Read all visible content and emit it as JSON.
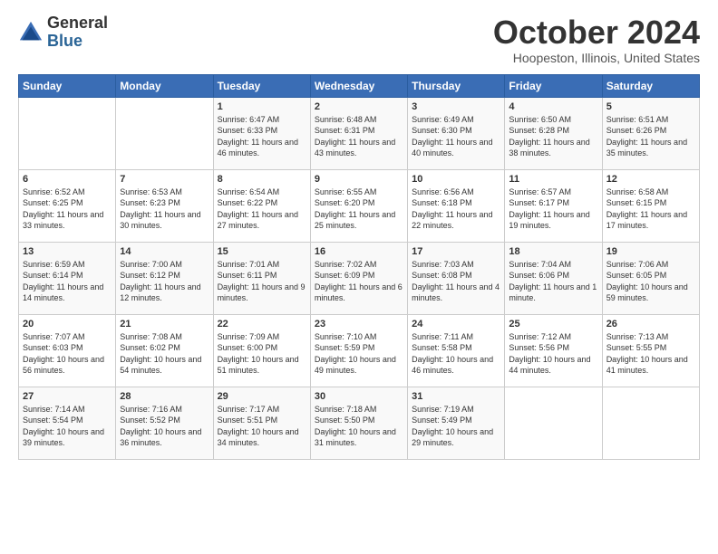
{
  "logo": {
    "general": "General",
    "blue": "Blue"
  },
  "header": {
    "month": "October 2024",
    "location": "Hoopeston, Illinois, United States"
  },
  "days_of_week": [
    "Sunday",
    "Monday",
    "Tuesday",
    "Wednesday",
    "Thursday",
    "Friday",
    "Saturday"
  ],
  "weeks": [
    [
      {
        "day": "",
        "info": ""
      },
      {
        "day": "",
        "info": ""
      },
      {
        "day": "1",
        "info": "Sunrise: 6:47 AM\nSunset: 6:33 PM\nDaylight: 11 hours and 46 minutes."
      },
      {
        "day": "2",
        "info": "Sunrise: 6:48 AM\nSunset: 6:31 PM\nDaylight: 11 hours and 43 minutes."
      },
      {
        "day": "3",
        "info": "Sunrise: 6:49 AM\nSunset: 6:30 PM\nDaylight: 11 hours and 40 minutes."
      },
      {
        "day": "4",
        "info": "Sunrise: 6:50 AM\nSunset: 6:28 PM\nDaylight: 11 hours and 38 minutes."
      },
      {
        "day": "5",
        "info": "Sunrise: 6:51 AM\nSunset: 6:26 PM\nDaylight: 11 hours and 35 minutes."
      }
    ],
    [
      {
        "day": "6",
        "info": "Sunrise: 6:52 AM\nSunset: 6:25 PM\nDaylight: 11 hours and 33 minutes."
      },
      {
        "day": "7",
        "info": "Sunrise: 6:53 AM\nSunset: 6:23 PM\nDaylight: 11 hours and 30 minutes."
      },
      {
        "day": "8",
        "info": "Sunrise: 6:54 AM\nSunset: 6:22 PM\nDaylight: 11 hours and 27 minutes."
      },
      {
        "day": "9",
        "info": "Sunrise: 6:55 AM\nSunset: 6:20 PM\nDaylight: 11 hours and 25 minutes."
      },
      {
        "day": "10",
        "info": "Sunrise: 6:56 AM\nSunset: 6:18 PM\nDaylight: 11 hours and 22 minutes."
      },
      {
        "day": "11",
        "info": "Sunrise: 6:57 AM\nSunset: 6:17 PM\nDaylight: 11 hours and 19 minutes."
      },
      {
        "day": "12",
        "info": "Sunrise: 6:58 AM\nSunset: 6:15 PM\nDaylight: 11 hours and 17 minutes."
      }
    ],
    [
      {
        "day": "13",
        "info": "Sunrise: 6:59 AM\nSunset: 6:14 PM\nDaylight: 11 hours and 14 minutes."
      },
      {
        "day": "14",
        "info": "Sunrise: 7:00 AM\nSunset: 6:12 PM\nDaylight: 11 hours and 12 minutes."
      },
      {
        "day": "15",
        "info": "Sunrise: 7:01 AM\nSunset: 6:11 PM\nDaylight: 11 hours and 9 minutes."
      },
      {
        "day": "16",
        "info": "Sunrise: 7:02 AM\nSunset: 6:09 PM\nDaylight: 11 hours and 6 minutes."
      },
      {
        "day": "17",
        "info": "Sunrise: 7:03 AM\nSunset: 6:08 PM\nDaylight: 11 hours and 4 minutes."
      },
      {
        "day": "18",
        "info": "Sunrise: 7:04 AM\nSunset: 6:06 PM\nDaylight: 11 hours and 1 minute."
      },
      {
        "day": "19",
        "info": "Sunrise: 7:06 AM\nSunset: 6:05 PM\nDaylight: 10 hours and 59 minutes."
      }
    ],
    [
      {
        "day": "20",
        "info": "Sunrise: 7:07 AM\nSunset: 6:03 PM\nDaylight: 10 hours and 56 minutes."
      },
      {
        "day": "21",
        "info": "Sunrise: 7:08 AM\nSunset: 6:02 PM\nDaylight: 10 hours and 54 minutes."
      },
      {
        "day": "22",
        "info": "Sunrise: 7:09 AM\nSunset: 6:00 PM\nDaylight: 10 hours and 51 minutes."
      },
      {
        "day": "23",
        "info": "Sunrise: 7:10 AM\nSunset: 5:59 PM\nDaylight: 10 hours and 49 minutes."
      },
      {
        "day": "24",
        "info": "Sunrise: 7:11 AM\nSunset: 5:58 PM\nDaylight: 10 hours and 46 minutes."
      },
      {
        "day": "25",
        "info": "Sunrise: 7:12 AM\nSunset: 5:56 PM\nDaylight: 10 hours and 44 minutes."
      },
      {
        "day": "26",
        "info": "Sunrise: 7:13 AM\nSunset: 5:55 PM\nDaylight: 10 hours and 41 minutes."
      }
    ],
    [
      {
        "day": "27",
        "info": "Sunrise: 7:14 AM\nSunset: 5:54 PM\nDaylight: 10 hours and 39 minutes."
      },
      {
        "day": "28",
        "info": "Sunrise: 7:16 AM\nSunset: 5:52 PM\nDaylight: 10 hours and 36 minutes."
      },
      {
        "day": "29",
        "info": "Sunrise: 7:17 AM\nSunset: 5:51 PM\nDaylight: 10 hours and 34 minutes."
      },
      {
        "day": "30",
        "info": "Sunrise: 7:18 AM\nSunset: 5:50 PM\nDaylight: 10 hours and 31 minutes."
      },
      {
        "day": "31",
        "info": "Sunrise: 7:19 AM\nSunset: 5:49 PM\nDaylight: 10 hours and 29 minutes."
      },
      {
        "day": "",
        "info": ""
      },
      {
        "day": "",
        "info": ""
      }
    ]
  ]
}
